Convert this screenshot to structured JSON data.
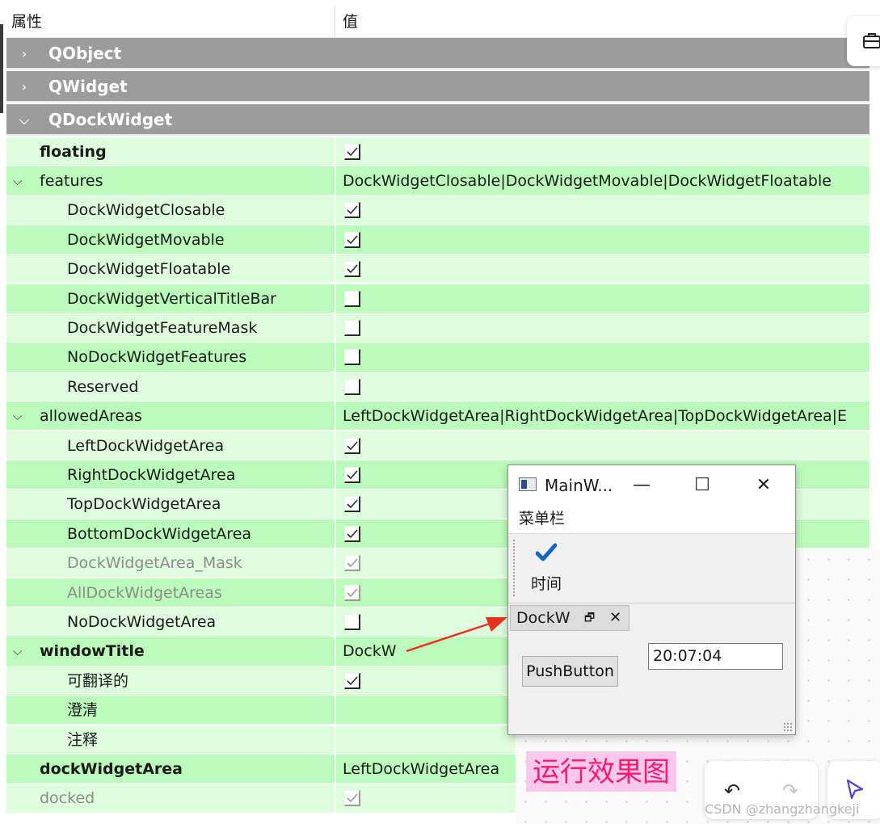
{
  "header": {
    "property": "属性",
    "value": "值"
  },
  "categories": [
    {
      "label": "QObject",
      "expanded": false
    },
    {
      "label": "QWidget",
      "expanded": false
    },
    {
      "label": "QDockWidget",
      "expanded": true
    }
  ],
  "rows": {
    "floating": {
      "name": "floating",
      "checked": true
    },
    "features": {
      "name": "features",
      "value": "DockWidgetClosable|DockWidgetMovable|DockWidgetFloatable"
    },
    "closable": {
      "name": "DockWidgetClosable",
      "checked": true
    },
    "movable": {
      "name": "DockWidgetMovable",
      "checked": true
    },
    "floatable": {
      "name": "DockWidgetFloatable",
      "checked": true
    },
    "vertical": {
      "name": "DockWidgetVerticalTitleBar",
      "checked": false
    },
    "featuremask": {
      "name": "DockWidgetFeatureMask",
      "checked": false
    },
    "nofeatures": {
      "name": "NoDockWidgetFeatures",
      "checked": false
    },
    "reserved": {
      "name": "Reserved",
      "checked": false
    },
    "allowedAreas": {
      "name": "allowedAreas",
      "value": "LeftDockWidgetArea|RightDockWidgetArea|TopDockWidgetArea|E"
    },
    "left": {
      "name": "LeftDockWidgetArea",
      "checked": true
    },
    "right": {
      "name": "RightDockWidgetArea",
      "checked": true
    },
    "top": {
      "name": "TopDockWidgetArea",
      "checked": true
    },
    "bottom": {
      "name": "BottomDockWidgetArea",
      "checked": true
    },
    "areamask": {
      "name": "DockWidgetArea_Mask",
      "checked": true
    },
    "allareas": {
      "name": "AllDockWidgetAreas",
      "checked": true
    },
    "noarea": {
      "name": "NoDockWidgetArea",
      "checked": false
    },
    "windowTitle": {
      "name": "windowTitle",
      "value": "DockW"
    },
    "translatable": {
      "name": "可翻译的",
      "checked": true
    },
    "disambiguation": {
      "name": "澄清"
    },
    "comment": {
      "name": "注释"
    },
    "dockWidgetArea": {
      "name": "dockWidgetArea",
      "value": "LeftDockWidgetArea"
    },
    "docked": {
      "name": "docked",
      "checked": true
    }
  },
  "mainwindow": {
    "title": "MainW...",
    "minimize": "—",
    "maximize": "☐",
    "close": "✕",
    "menubar": "菜单栏",
    "action_label": "时间",
    "dock_title": "DockW",
    "float_glyph": "🗗",
    "close_glyph": "✕",
    "button_label": "PushButton",
    "time_value": "20:07:04"
  },
  "caption": "运行效果图",
  "watermark": "CSDN @zhangzhangkeji",
  "tools": {
    "undo": "↶",
    "redo": "↷"
  },
  "colors": {
    "category_bg": "#9c9c9c",
    "row_light": "#ddfddd",
    "row_dark": "#bbfbbb",
    "caption_text": "#ff1a6e",
    "caption_bg": "#f9c8ec",
    "arrow": "#e8321e",
    "check_blue": "#1565c0"
  }
}
